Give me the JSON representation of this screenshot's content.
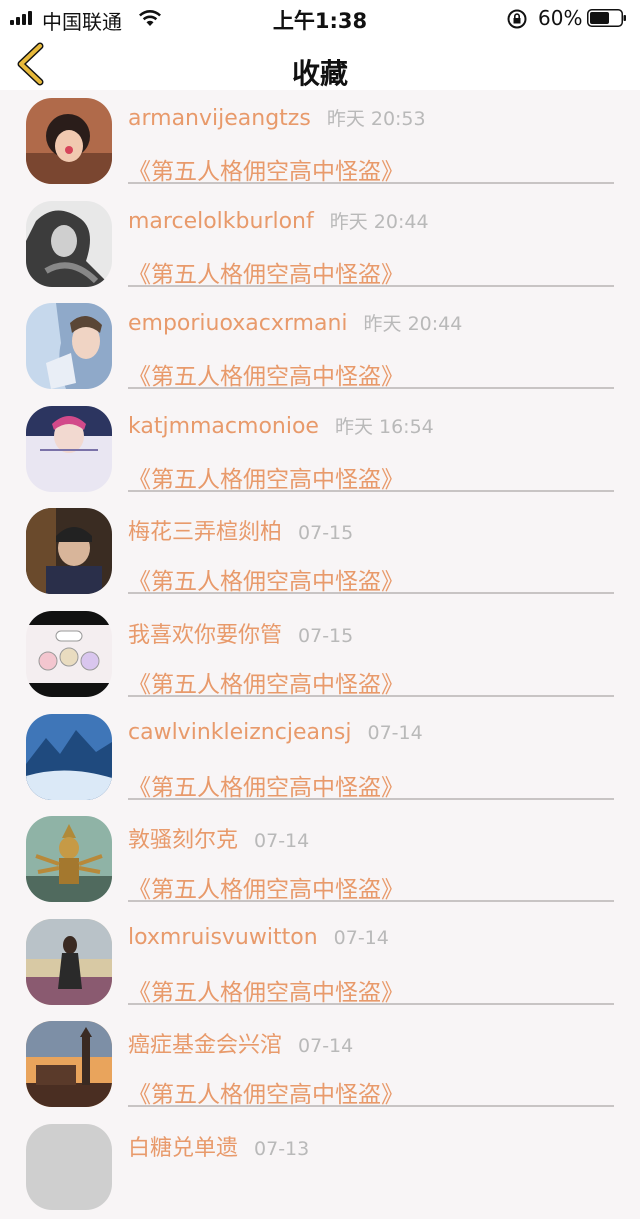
{
  "status_bar": {
    "carrier": "中国联通",
    "time": "上午1:38",
    "battery": "60%"
  },
  "nav": {
    "title": "收藏"
  },
  "items": [
    {
      "name": "armanvijeangtzs",
      "time": "昨天 20:53",
      "subtitle": "《第五人格佣空高中怪盗》"
    },
    {
      "name": "marcelolkburlonf",
      "time": "昨天 20:44",
      "subtitle": "《第五人格佣空高中怪盗》"
    },
    {
      "name": "emporiuoxacxrmani",
      "time": "昨天 20:44",
      "subtitle": "《第五人格佣空高中怪盗》"
    },
    {
      "name": "katjmmacmonioe",
      "time": "昨天 16:54",
      "subtitle": "《第五人格佣空高中怪盗》"
    },
    {
      "name": "梅花三弄楦剡柏",
      "time": "07-15",
      "subtitle": "《第五人格佣空高中怪盗》"
    },
    {
      "name": "我喜欢你要你管",
      "time": "07-15",
      "subtitle": "《第五人格佣空高中怪盗》"
    },
    {
      "name": "cawlvinkleizncjeansj",
      "time": "07-14",
      "subtitle": "《第五人格佣空高中怪盗》"
    },
    {
      "name": "敦骚刻尔克",
      "time": "07-14",
      "subtitle": "《第五人格佣空高中怪盗》"
    },
    {
      "name": "loxmruisvuwitton",
      "time": "07-14",
      "subtitle": "《第五人格佣空高中怪盗》"
    },
    {
      "name": "癌症基金会兴涫",
      "time": "07-14",
      "subtitle": "《第五人格佣空高中怪盗》"
    },
    {
      "name": "白糖兑单遗",
      "time": "07-13",
      "subtitle": ""
    }
  ],
  "colors": {
    "accent": "#e89a6b",
    "time_gray": "#b9b9b9",
    "back_arrow": "#e7b93b"
  },
  "icons": {
    "back": "back-arrow-icon",
    "signal": "signal-icon",
    "wifi": "wifi-icon",
    "lock": "rotation-lock-icon",
    "battery": "battery-icon"
  }
}
